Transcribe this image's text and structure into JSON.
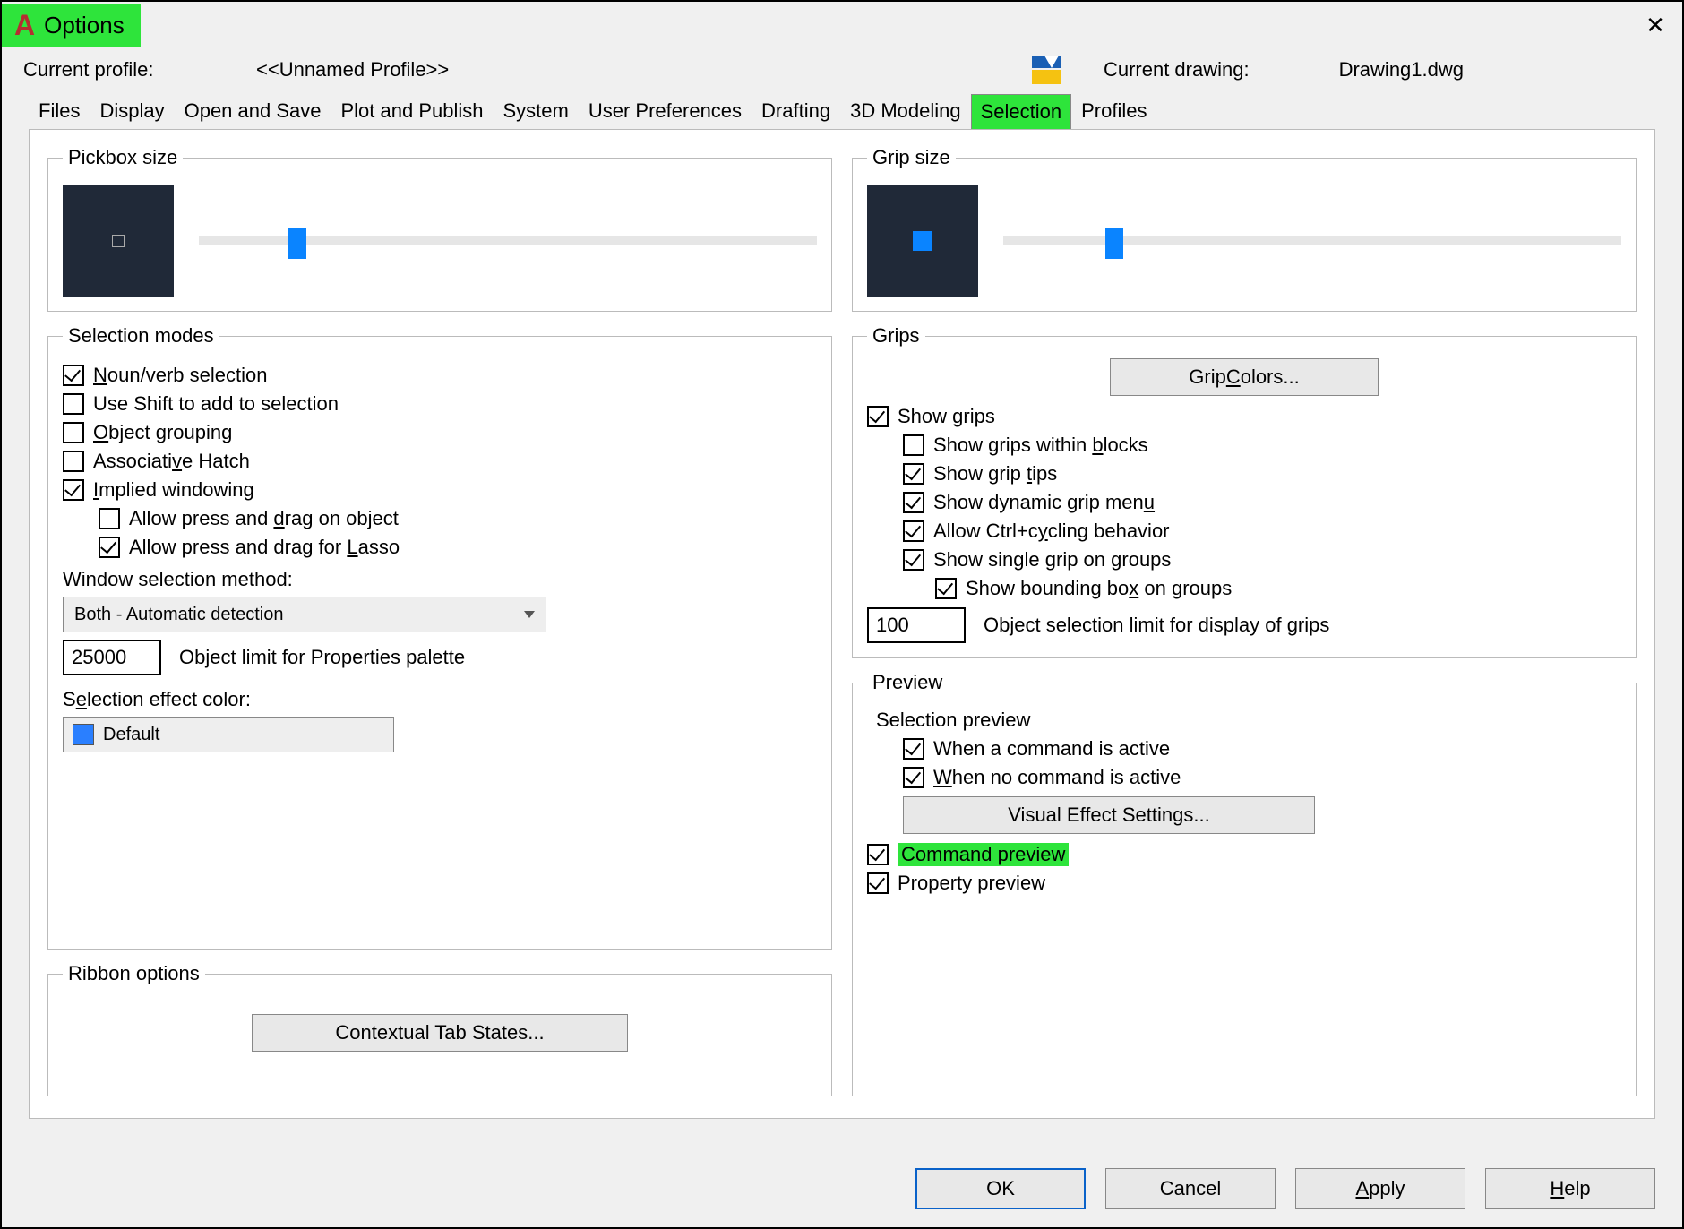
{
  "window": {
    "title": "Options",
    "close_glyph": "✕"
  },
  "header": {
    "profile_label": "Current profile:",
    "profile_value": "<<Unnamed Profile>>",
    "drawing_label": "Current drawing:",
    "drawing_value": "Drawing1.dwg"
  },
  "tabs": {
    "items": [
      {
        "label": "Files"
      },
      {
        "label": "Display"
      },
      {
        "label": "Open and Save"
      },
      {
        "label": "Plot and Publish"
      },
      {
        "label": "System"
      },
      {
        "label": "User Preferences"
      },
      {
        "label": "Drafting"
      },
      {
        "label": "3D Modeling"
      },
      {
        "label": "Selection"
      },
      {
        "label": "Profiles"
      }
    ],
    "active_index": 8
  },
  "pickbox": {
    "legend": "Pickbox size",
    "slider_pct": 16
  },
  "gripsize": {
    "legend": "Grip size",
    "slider_pct": 18
  },
  "selection_modes": {
    "legend": "Selection modes",
    "noun_verb": {
      "label_pre": "",
      "u": "N",
      "label_post": "oun/verb selection",
      "checked": true
    },
    "shift_add": {
      "label": "Use Shift to add to selection",
      "checked": false
    },
    "obj_group": {
      "label_pre": "",
      "u": "O",
      "label_post": "bject grouping",
      "checked": false
    },
    "assoc_hatch": {
      "label_pre": "Associati",
      "u": "v",
      "label_post": "e Hatch",
      "checked": false
    },
    "implied": {
      "label_pre": "",
      "u": "I",
      "label_post": "mplied windowing",
      "checked": true
    },
    "press_drag_obj": {
      "label_pre": "Allow press and ",
      "u": "d",
      "label_post": "rag on object",
      "checked": false
    },
    "press_drag_lasso": {
      "label_pre": "Allow press and drag for ",
      "u": "L",
      "label_post": "asso",
      "checked": true
    },
    "win_method_label": "Window selection method:",
    "win_method_value": "Both - Automatic detection",
    "obj_limit_value": "25000",
    "obj_limit_label": "Object limit for Properties palette",
    "sel_color_label_pre": "S",
    "sel_color_u": "e",
    "sel_color_label_post": "lection effect color:",
    "sel_color_value": "Default"
  },
  "ribbon": {
    "legend": "Ribbon options",
    "contextual_btn": "Contextual Tab States..."
  },
  "grips": {
    "legend": "Grips",
    "colors_btn_pre": "Grip ",
    "colors_btn_u": "C",
    "colors_btn_post": "olors...",
    "show_grips": {
      "label": "Show grips",
      "checked": true
    },
    "within_blocks": {
      "label_pre": "Show grips within ",
      "u": "b",
      "label_post": "locks",
      "checked": false
    },
    "grip_tips": {
      "label_pre": "Show grip ",
      "u": "t",
      "label_post": "ips",
      "checked": true
    },
    "dyn_menu": {
      "label_pre": "Show dynamic grip men",
      "u": "u",
      "label_post": "",
      "checked": true
    },
    "ctrl_cycle": {
      "label_pre": "Allow Ctrl+c",
      "u": "y",
      "label_post": "cling behavior",
      "checked": true
    },
    "single_grip": {
      "label_pre": "Show single ",
      "u": "g",
      "label_post": "rip on groups",
      "checked": true
    },
    "bbox_groups": {
      "label_pre": "Show bounding bo",
      "u": "x",
      "label_post": " on groups",
      "checked": true
    },
    "grip_limit_value": "100",
    "grip_limit_label": "Object selection limit for display of grips"
  },
  "preview": {
    "legend": "Preview",
    "sel_preview_title": "Selection preview",
    "cmd_active": {
      "label": "When a command is active",
      "checked": true
    },
    "no_cmd": {
      "label_pre": "",
      "u": "W",
      "label_post": "hen no command is active",
      "checked": true
    },
    "visual_btn": "Visual Effect Settings...",
    "cmd_preview": {
      "label": "Command preview",
      "checked": true,
      "highlight": true
    },
    "prop_preview": {
      "label": "Property preview",
      "checked": true
    }
  },
  "footer": {
    "ok": "OK",
    "cancel": "Cancel",
    "apply_pre": "",
    "apply_u": "A",
    "apply_post": "pply",
    "help_pre": "",
    "help_u": "H",
    "help_post": "elp"
  }
}
